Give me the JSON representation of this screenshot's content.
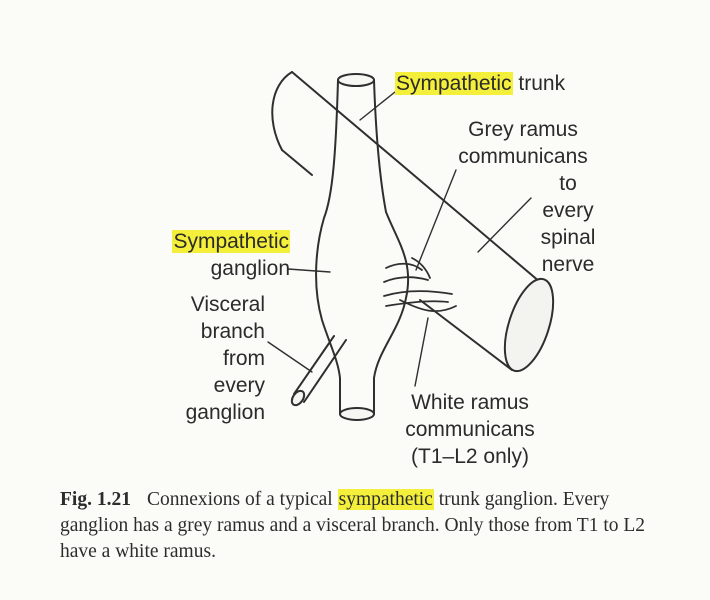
{
  "labels": {
    "trunk_hl": "Sympathetic",
    "trunk_rest": " trunk",
    "grey_ramus": [
      "Grey ramus",
      "communicans"
    ],
    "to_every": [
      "to",
      "every",
      "spinal",
      "nerve"
    ],
    "ganglion_hl": "Sympathetic",
    "ganglion_rest": "ganglion",
    "visceral": [
      "Visceral",
      "branch",
      "from",
      "every",
      "ganglion"
    ],
    "white_ramus": [
      "White ramus",
      "communicans",
      "(T1–L2 only)"
    ]
  },
  "caption": {
    "fig_label": "Fig. 1.21",
    "pre": "Connexions of a typical ",
    "hl": "sympathetic",
    "post": " trunk ganglion. Every ganglion has a grey ramus and a visceral branch. Only those from T1 to L2 have a white ramus."
  },
  "colors": {
    "highlight": "#f4ef3a",
    "ink": "#2a2a2a",
    "background": "#fbfbf8"
  }
}
